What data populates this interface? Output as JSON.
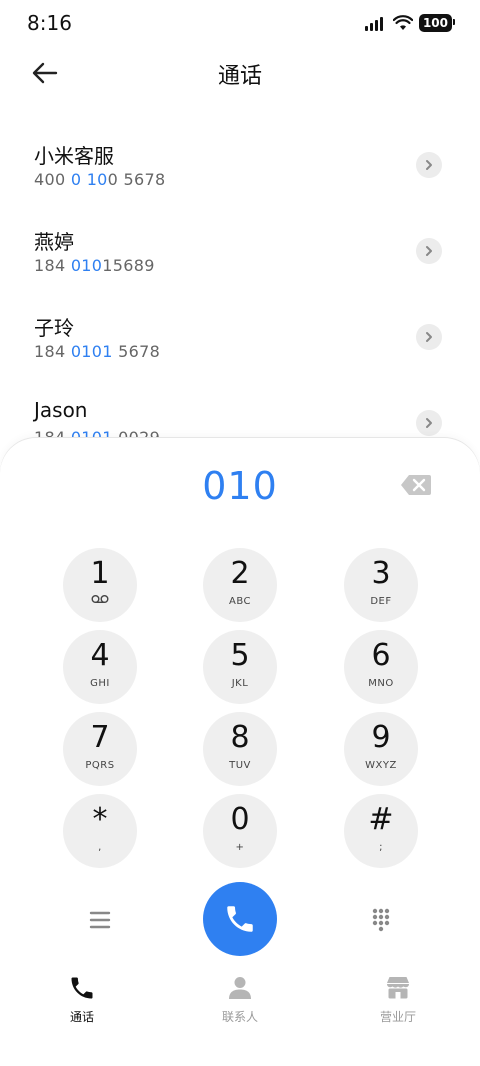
{
  "status": {
    "time": "8:16",
    "battery": "100"
  },
  "header": {
    "title": "通话"
  },
  "contacts": [
    {
      "name": "小米客服",
      "num_pre": "400 ",
      "num_hl": "0 10",
      "num_post": "0 5678"
    },
    {
      "name": "燕婷",
      "num_pre": "184 ",
      "num_hl": "010",
      "num_post": "15689"
    },
    {
      "name": "子玲",
      "num_pre": "184 ",
      "num_hl": "0101",
      "num_post": " 5678"
    },
    {
      "name": "Jason",
      "num_pre": "184 ",
      "num_hl": "0101",
      "num_post": " 0029"
    }
  ],
  "dialer": {
    "display": "010",
    "keys": [
      {
        "digit": "1",
        "letters": ""
      },
      {
        "digit": "2",
        "letters": "ABC"
      },
      {
        "digit": "3",
        "letters": "DEF"
      },
      {
        "digit": "4",
        "letters": "GHI"
      },
      {
        "digit": "5",
        "letters": "JKL"
      },
      {
        "digit": "6",
        "letters": "MNO"
      },
      {
        "digit": "7",
        "letters": "PQRS"
      },
      {
        "digit": "8",
        "letters": "TUV"
      },
      {
        "digit": "9",
        "letters": "WXYZ"
      },
      {
        "digit": "*",
        "letters": ","
      },
      {
        "digit": "0",
        "letters": "+"
      },
      {
        "digit": "#",
        "letters": ";"
      }
    ]
  },
  "tabs": [
    {
      "label": "通话",
      "active": true
    },
    {
      "label": "联系人",
      "active": false
    },
    {
      "label": "营业厅",
      "active": false
    }
  ],
  "colors": {
    "accent": "#2f80f1",
    "key_bg": "#efefef",
    "text": "#111111"
  }
}
